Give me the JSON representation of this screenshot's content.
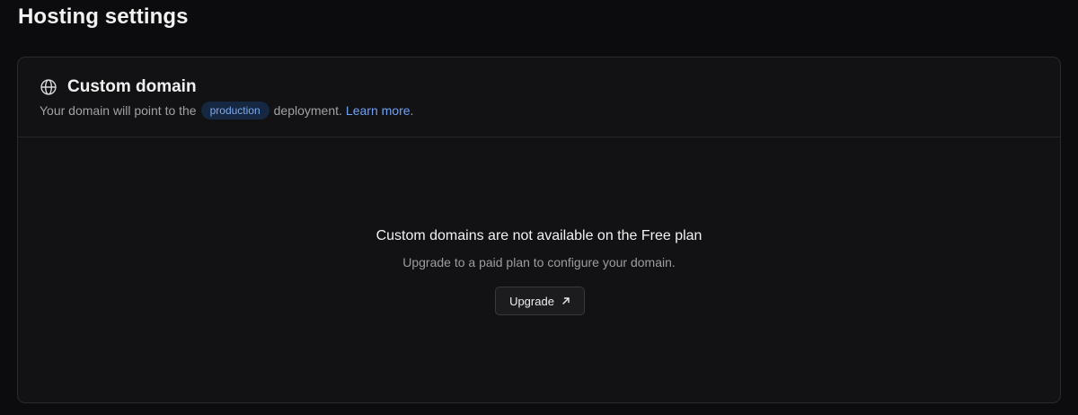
{
  "page": {
    "title": "Hosting settings"
  },
  "custom_domain": {
    "icon": "globe-icon",
    "title": "Custom domain",
    "subtitle_prefix": "Your domain will point to the",
    "environment_badge": "production",
    "subtitle_suffix": "deployment.",
    "learn_more_label": "Learn more",
    "subtitle_end": "."
  },
  "empty_state": {
    "title": "Custom domains are not available on the Free plan",
    "description": "Upgrade to a paid plan to configure your domain.",
    "upgrade_label": "Upgrade",
    "upgrade_icon": "external-arrow-icon"
  },
  "colors": {
    "background": "#0c0c0e",
    "card": "#121214",
    "border": "#2a2a2e",
    "link": "#6da2f5",
    "badge_bg": "#162742",
    "badge_text": "#7aaaf0"
  }
}
